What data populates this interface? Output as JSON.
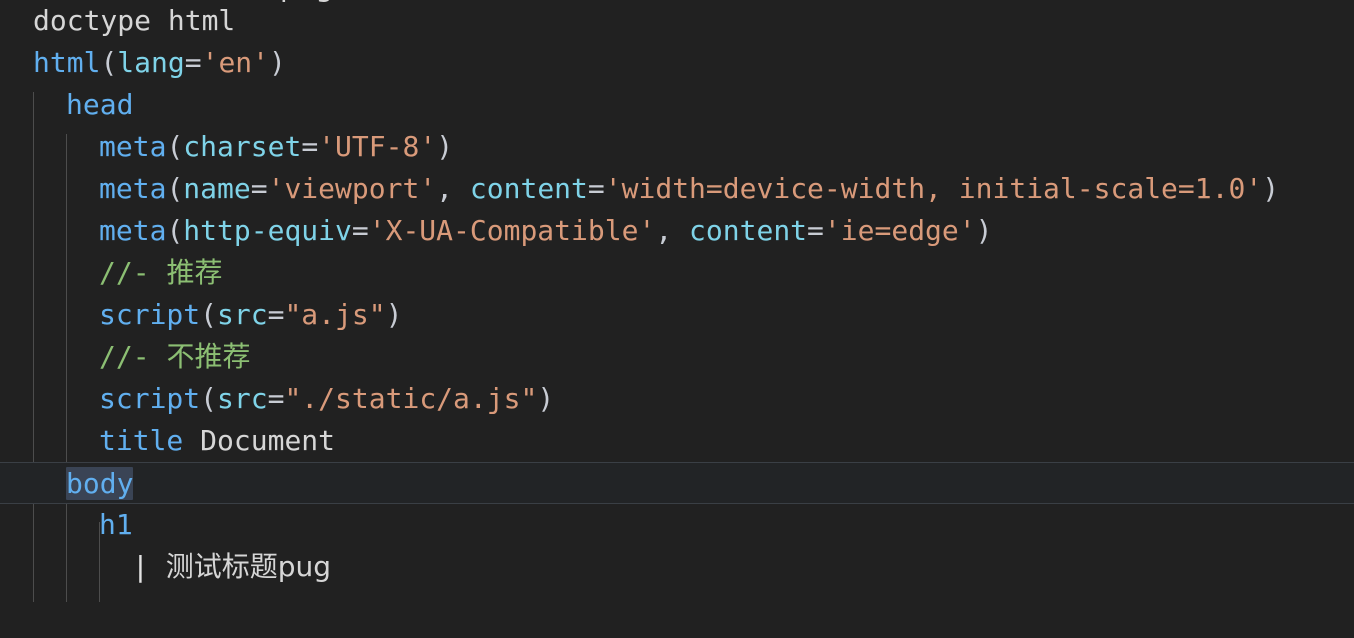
{
  "editor": {
    "language": "pug",
    "theme": "dark",
    "background": "#212121",
    "current_line_background": "#222426",
    "selection_background": "#3a4455",
    "colors": {
      "tag": "#61afef",
      "attribute": "#7fd3e8",
      "string": "#d99a7a",
      "punctuation": "#c8ccd4",
      "plain_text": "#d6d6d6",
      "comment": "#8cbf73",
      "indent_guide": "#5c5c5c"
    }
  },
  "partial_top_line": {
    "text": "测试标题pug"
  },
  "lines": [
    {
      "id": "line-doctype",
      "indent": 0,
      "tokens": [
        {
          "kind": "plain",
          "text": "doctype html"
        }
      ]
    },
    {
      "id": "line-html",
      "indent": 0,
      "tokens": [
        {
          "kind": "tag",
          "text": "html"
        },
        {
          "kind": "punc",
          "text": "("
        },
        {
          "kind": "attr",
          "text": "lang"
        },
        {
          "kind": "punc",
          "text": "="
        },
        {
          "kind": "str",
          "text": "'en'"
        },
        {
          "kind": "punc",
          "text": ")"
        }
      ]
    },
    {
      "id": "line-head",
      "indent": 1,
      "tokens": [
        {
          "kind": "tag",
          "text": "head"
        }
      ]
    },
    {
      "id": "line-meta-charset",
      "indent": 2,
      "tokens": [
        {
          "kind": "tag",
          "text": "meta"
        },
        {
          "kind": "punc",
          "text": "("
        },
        {
          "kind": "attr",
          "text": "charset"
        },
        {
          "kind": "punc",
          "text": "="
        },
        {
          "kind": "str",
          "text": "'UTF-8'"
        },
        {
          "kind": "punc",
          "text": ")"
        }
      ]
    },
    {
      "id": "line-meta-viewport",
      "indent": 2,
      "tokens": [
        {
          "kind": "tag",
          "text": "meta"
        },
        {
          "kind": "punc",
          "text": "("
        },
        {
          "kind": "attr",
          "text": "name"
        },
        {
          "kind": "punc",
          "text": "="
        },
        {
          "kind": "str",
          "text": "'viewport'"
        },
        {
          "kind": "punc",
          "text": ", "
        },
        {
          "kind": "attr",
          "text": "content"
        },
        {
          "kind": "punc",
          "text": "="
        },
        {
          "kind": "str",
          "text": "'width=device-width, initial-scale=1.0'"
        },
        {
          "kind": "punc",
          "text": ")"
        }
      ]
    },
    {
      "id": "line-meta-httpequiv",
      "indent": 2,
      "tokens": [
        {
          "kind": "tag",
          "text": "meta"
        },
        {
          "kind": "punc",
          "text": "("
        },
        {
          "kind": "attr",
          "text": "http-equiv"
        },
        {
          "kind": "punc",
          "text": "="
        },
        {
          "kind": "str",
          "text": "'X-UA-Compatible'"
        },
        {
          "kind": "punc",
          "text": ", "
        },
        {
          "kind": "attr",
          "text": "content"
        },
        {
          "kind": "punc",
          "text": "="
        },
        {
          "kind": "str",
          "text": "'ie=edge'"
        },
        {
          "kind": "punc",
          "text": ")"
        }
      ]
    },
    {
      "id": "line-comment-recommended",
      "indent": 2,
      "tokens": [
        {
          "kind": "comment",
          "text": "//- "
        },
        {
          "kind": "comment-cjk",
          "text": "推荐"
        }
      ]
    },
    {
      "id": "line-script-ajs",
      "indent": 2,
      "tokens": [
        {
          "kind": "tag",
          "text": "script"
        },
        {
          "kind": "punc",
          "text": "("
        },
        {
          "kind": "attr",
          "text": "src"
        },
        {
          "kind": "punc",
          "text": "="
        },
        {
          "kind": "str",
          "text": "\"a.js\""
        },
        {
          "kind": "punc",
          "text": ")"
        }
      ]
    },
    {
      "id": "line-comment-not-recommended",
      "indent": 2,
      "tokens": [
        {
          "kind": "comment",
          "text": "//- "
        },
        {
          "kind": "comment-cjk",
          "text": "不推荐"
        }
      ]
    },
    {
      "id": "line-script-static-ajs",
      "indent": 2,
      "tokens": [
        {
          "kind": "tag",
          "text": "script"
        },
        {
          "kind": "punc",
          "text": "("
        },
        {
          "kind": "attr",
          "text": "src"
        },
        {
          "kind": "punc",
          "text": "="
        },
        {
          "kind": "str",
          "text": "\"./static/a.js\""
        },
        {
          "kind": "punc",
          "text": ")"
        }
      ]
    },
    {
      "id": "line-title",
      "indent": 2,
      "tokens": [
        {
          "kind": "tag",
          "text": "title"
        },
        {
          "kind": "plain",
          "text": " Document"
        }
      ]
    },
    {
      "id": "line-body",
      "indent": 1,
      "current": true,
      "tokens": [
        {
          "kind": "tag",
          "text": "body",
          "selected": true
        }
      ]
    },
    {
      "id": "line-h1",
      "indent": 2,
      "tokens": [
        {
          "kind": "tag",
          "text": "h1"
        }
      ]
    },
    {
      "id": "line-h1-text",
      "indent": 3,
      "tokens": [
        {
          "kind": "pipe",
          "text": "| "
        },
        {
          "kind": "plain-cjk",
          "text": "测试标题pug"
        }
      ]
    }
  ]
}
